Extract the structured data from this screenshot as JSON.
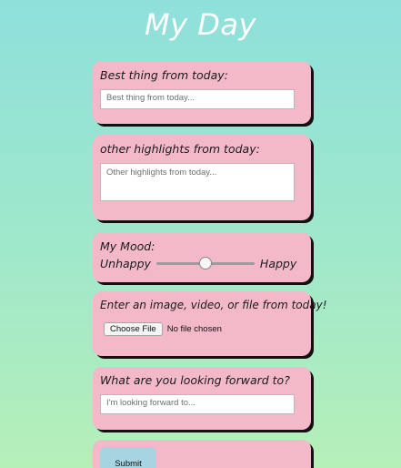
{
  "page": {
    "title": "My Day"
  },
  "best_thing": {
    "label": "Best thing from today:",
    "placeholder": "Best thing from today...",
    "value": ""
  },
  "highlights": {
    "label": "other highlights from today:",
    "placeholder": "Other highlights from today...",
    "value": ""
  },
  "mood": {
    "label": "My Mood:",
    "min_label": "Unhappy",
    "max_label": "Happy",
    "value_fraction": 0.5
  },
  "upload": {
    "label": "Enter an image, video, or file from today!",
    "button_label": "Choose File",
    "status": "No file chosen"
  },
  "forward": {
    "label": "What are you looking forward to?",
    "placeholder": "I'm looking forward to...",
    "value": ""
  },
  "submit": {
    "label": "Submit"
  },
  "colors": {
    "card": "#f4b9c9",
    "submit": "#a6d4e0",
    "title": "#ffffff"
  }
}
